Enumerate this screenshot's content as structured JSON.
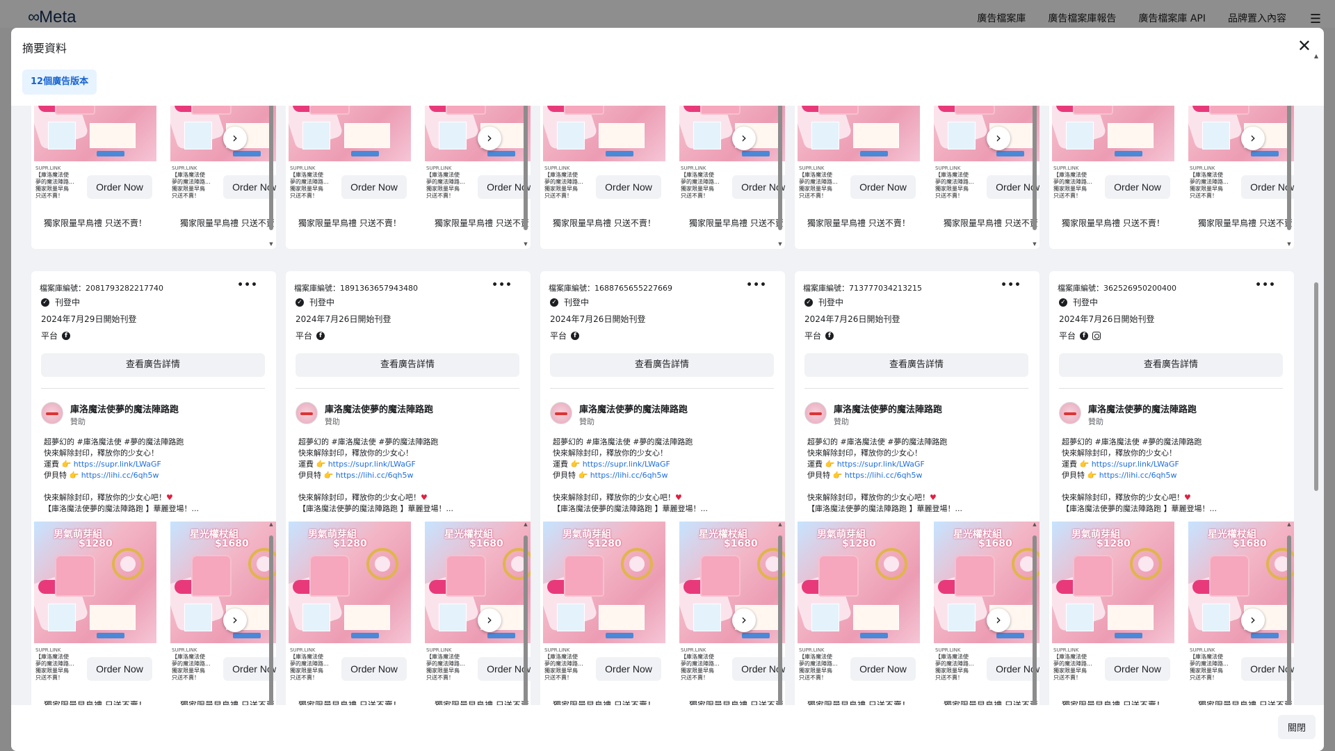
{
  "nav": {
    "logo": "Meta",
    "links": [
      "廣告檔案庫",
      "廣告檔案庫報告",
      "廣告檔案庫 API",
      "品牌置入內容"
    ]
  },
  "modal": {
    "title": "摘要資料",
    "tab": "12個廣告版本",
    "close_button": "關閉"
  },
  "common": {
    "status": "刊登中",
    "platform_label": "平台",
    "detail_button": "查看廣告詳情",
    "page_name": "庫洛魔法使夢的魔法陣路跑",
    "sponsored": "贊助",
    "body": [
      "超夢幻的 #庫洛魔法使 #夢的魔法陣路跑",
      "快來解除封印，釋放你的少女心！",
      "運費",
      "https://supr.link/LWaGF",
      "伊貝特",
      "https://lihi.cc/6qh5w",
      "快來解除封印，釋放你的少女心吧！",
      "【庫洛魔法使夢的魔法陣路跑 】華麗登場！..."
    ],
    "slides": [
      {
        "tag": "男氣萌芽組",
        "price": "$1280",
        "domain": "SUPR.LINK",
        "title": [
          "【庫洛魔法使",
          "夢的魔法陣路...",
          "獨家限量早鳥",
          "只送不賣！"
        ],
        "cta": "Order Now",
        "footer": "獨家限量早鳥禮 只送不賣！"
      },
      {
        "tag": "星光權杖組",
        "price": "$1680",
        "domain": "SUPR.LINK",
        "title": [
          "【庫洛魔法使",
          "夢的魔法陣路...",
          "獨家限量早鳥",
          "只送不賣！"
        ],
        "cta": "Order Now",
        "footer": "獨家限量早鳥禮 只送不賣！"
      }
    ]
  },
  "cards": [
    {
      "library_id": "檔案庫編號：2081793282217740",
      "date": "2024年7月29日開始刊登",
      "platforms": [
        "facebook"
      ]
    },
    {
      "library_id": "檔案庫編號：1891363657943480",
      "date": "2024年7月26日開始刊登",
      "platforms": [
        "facebook"
      ]
    },
    {
      "library_id": "檔案庫編號：1688765655227669",
      "date": "2024年7月26日開始刊登",
      "platforms": [
        "facebook"
      ]
    },
    {
      "library_id": "檔案庫編號：713777034213215",
      "date": "2024年7月26日開始刊登",
      "platforms": [
        "facebook"
      ]
    },
    {
      "library_id": "檔案庫編號：362526950200400",
      "date": "2024年7月26日開始刊登",
      "platforms": [
        "facebook",
        "instagram"
      ]
    }
  ]
}
